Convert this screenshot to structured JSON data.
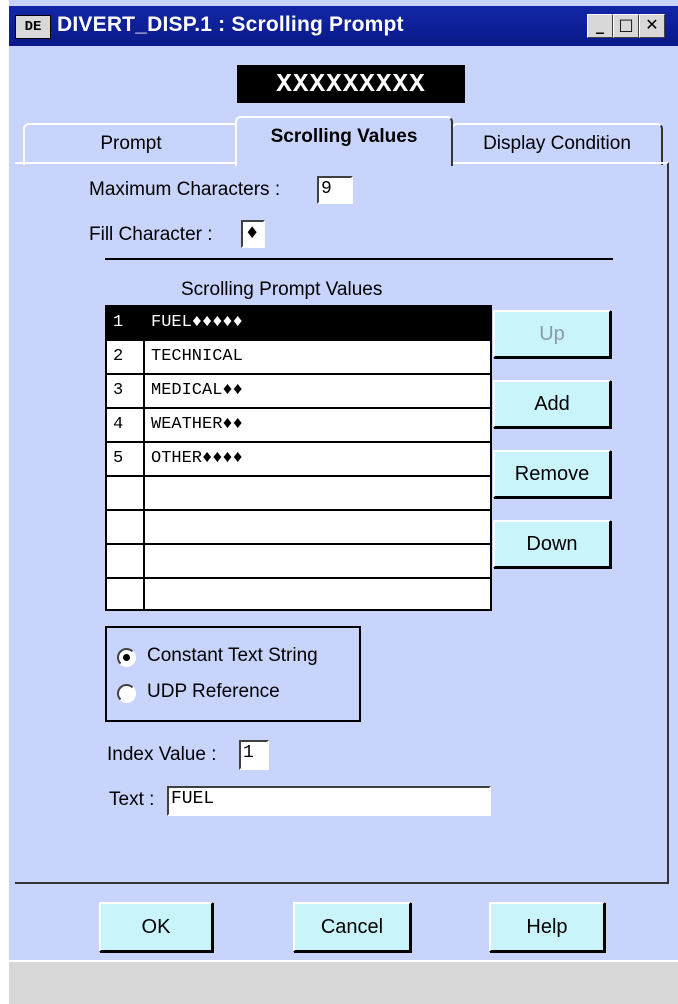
{
  "window": {
    "title": "DIVERT_DISP.1 : Scrolling Prompt",
    "app_icon": "DE"
  },
  "preview_text": "XXXXXXXXX",
  "tabs": [
    {
      "label": "Prompt",
      "active": false
    },
    {
      "label": "Scrolling Values",
      "active": true
    },
    {
      "label": "Display Condition",
      "active": false
    }
  ],
  "max_chars": {
    "label": "Maximum Characters :",
    "value": "9"
  },
  "fill_char": {
    "label": "Fill Character :",
    "value": "♦"
  },
  "list": {
    "title": "Scrolling Prompt Values",
    "rows": [
      {
        "index": "1",
        "value": "FUEL♦♦♦♦♦"
      },
      {
        "index": "2",
        "value": "TECHNICAL"
      },
      {
        "index": "3",
        "value": "MEDICAL♦♦"
      },
      {
        "index": "4",
        "value": "WEATHER♦♦"
      },
      {
        "index": "5",
        "value": "OTHER♦♦♦♦"
      },
      {
        "index": "",
        "value": ""
      },
      {
        "index": "",
        "value": ""
      },
      {
        "index": "",
        "value": ""
      },
      {
        "index": "",
        "value": ""
      }
    ],
    "selected_index": 0
  },
  "side_buttons": {
    "up": "Up",
    "add": "Add",
    "remove": "Remove",
    "down": "Down"
  },
  "radio": {
    "constant": "Constant Text String",
    "udp": "UDP Reference",
    "selected": "constant"
  },
  "index_value": {
    "label": "Index Value :",
    "value": "1"
  },
  "text_field": {
    "label": "Text :",
    "value": "FUEL"
  },
  "footer": {
    "ok": "OK",
    "cancel": "Cancel",
    "help": "Help"
  },
  "colors": {
    "window_bg": "#c8d4fc",
    "button_bg": "#c8f4fa",
    "titlebar": "#1226a6"
  }
}
